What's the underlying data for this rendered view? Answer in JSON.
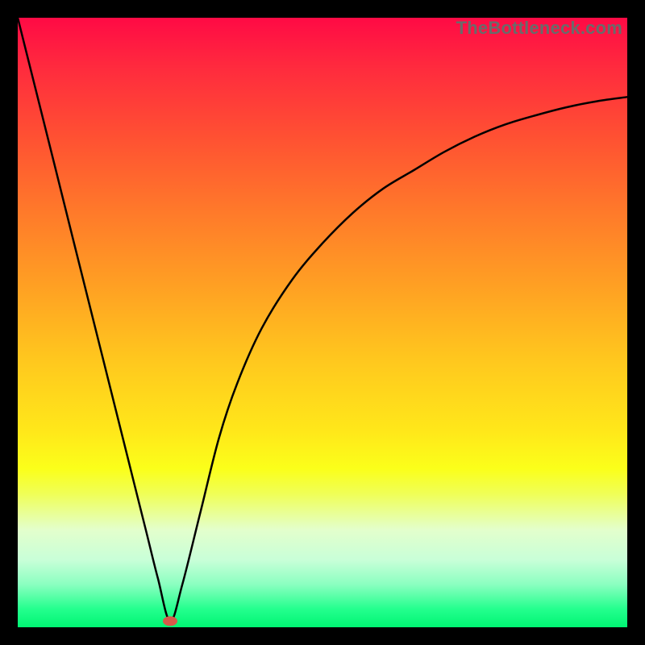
{
  "watermark": "TheBottleneck.com",
  "chart_data": {
    "type": "line",
    "title": "",
    "xlabel": "",
    "ylabel": "",
    "xlim": [
      0,
      100
    ],
    "ylim": [
      0,
      100
    ],
    "grid": false,
    "legend": false,
    "series": [
      {
        "name": "bottleneck-curve",
        "x": [
          0,
          3,
          6,
          9,
          12,
          15,
          18,
          21,
          23,
          25,
          27,
          30,
          33,
          36,
          40,
          45,
          50,
          55,
          60,
          65,
          70,
          75,
          80,
          85,
          90,
          95,
          100
        ],
        "values": [
          100,
          88,
          76,
          64,
          52,
          40,
          28,
          16,
          8,
          1,
          7,
          19,
          31,
          40,
          49,
          57,
          63,
          68,
          72,
          75,
          78,
          80.5,
          82.5,
          84,
          85.3,
          86.3,
          87
        ]
      }
    ],
    "marker": {
      "x": 25,
      "y": 1,
      "color": "#d65a4a"
    }
  }
}
